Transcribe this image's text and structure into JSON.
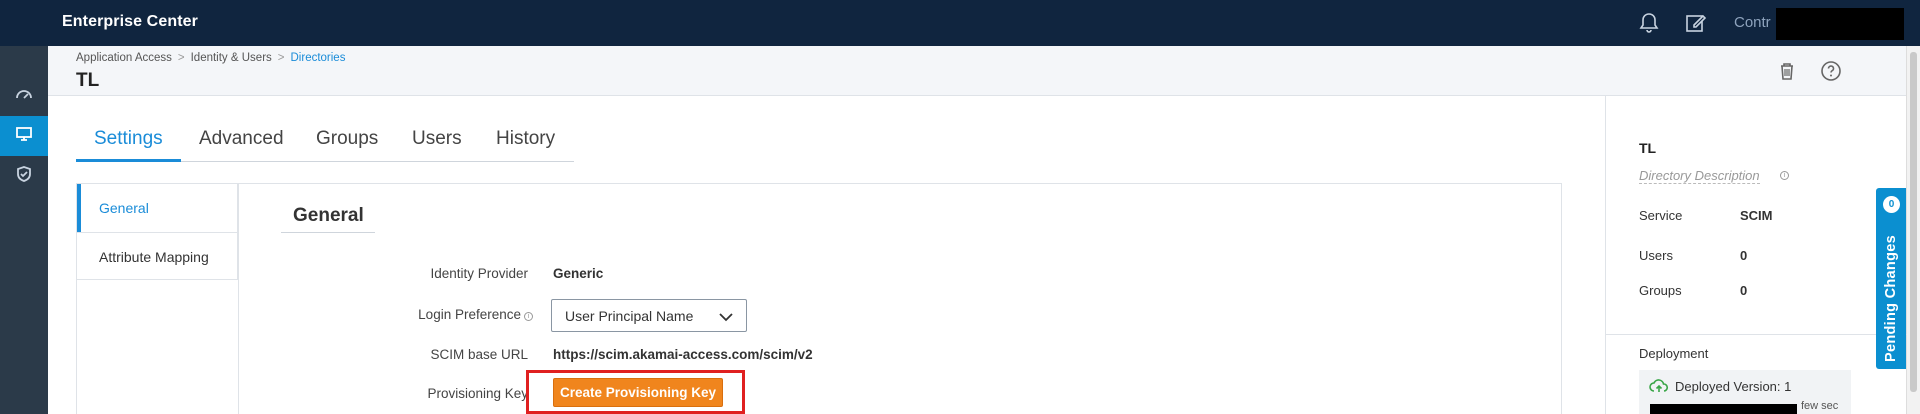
{
  "app": {
    "title": "Enterprise Center"
  },
  "topbar": {
    "user_label": "Contr"
  },
  "breadcrumb": [
    "Application Access",
    "Identity & Users",
    "Directories"
  ],
  "page": {
    "title": "TL"
  },
  "tabs": [
    "Settings",
    "Advanced",
    "Groups",
    "Users",
    "History"
  ],
  "active_tab": "Settings",
  "subnav": [
    "General",
    "Attribute Mapping"
  ],
  "section": {
    "title": "General",
    "fields": {
      "identity_provider": {
        "label": "Identity Provider",
        "value": "Generic"
      },
      "login_preference": {
        "label": "Login Preference",
        "value": "User Principal Name"
      },
      "scim_base_url": {
        "label": "SCIM base URL",
        "value": "https://scim.akamai-access.com/scim/v2"
      },
      "provisioning_key": {
        "label": "Provisioning Key",
        "button": "Create Provisioning Key"
      }
    }
  },
  "right_panel": {
    "title": "TL",
    "description_placeholder": "Directory Description",
    "service": {
      "label": "Service",
      "value": "SCIM"
    },
    "users": {
      "label": "Users",
      "value": "0"
    },
    "groups": {
      "label": "Groups",
      "value": "0"
    },
    "deployment": {
      "title": "Deployment",
      "version": "Deployed Version: 1",
      "time_suffix": "few sec"
    }
  },
  "pending_changes": {
    "label": "Pending Changes",
    "count": "0"
  },
  "colors": {
    "topbar": "#10253f",
    "accent": "#1a8cd8",
    "button": "#f0851d",
    "highlight": "#e02020"
  },
  "icons": [
    "bell-icon",
    "edit-icon",
    "dashboard-icon",
    "monitor-icon",
    "shield-check-icon",
    "trash-icon",
    "help-icon",
    "cloud-upload-icon",
    "chevron-down-icon",
    "info-icon"
  ]
}
